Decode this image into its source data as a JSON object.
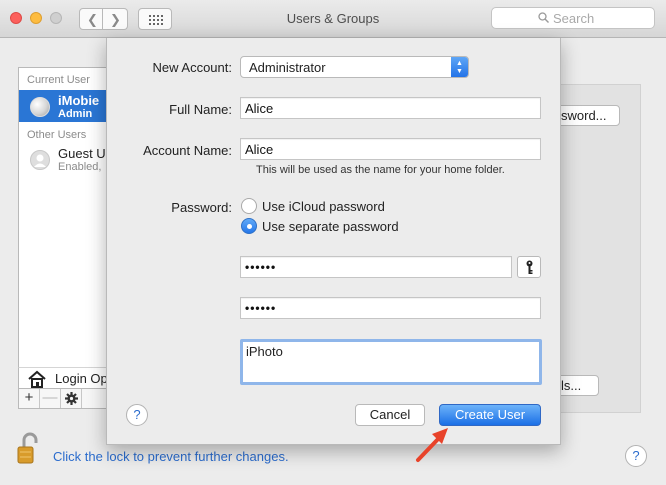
{
  "window": {
    "title": "Users & Groups"
  },
  "search": {
    "placeholder": "Search"
  },
  "user_list": {
    "current_label": "Current User",
    "other_label": "Other Users",
    "current_user": {
      "name": "iMobie",
      "role": "Admin"
    },
    "other_users": [
      {
        "name": "Guest U",
        "status": "Enabled,"
      }
    ],
    "login_options": "Login Op"
  },
  "list_bar": {
    "add": "+",
    "remove": "—"
  },
  "background_buttons": {
    "change_password": "sword...",
    "parental": "ls..."
  },
  "lock": {
    "text": "Click the lock to prevent further changes."
  },
  "help": {
    "glyph": "?"
  },
  "sheet": {
    "new_account_label": "New Account:",
    "new_account_value": "Administrator",
    "full_name_label": "Full Name:",
    "full_name_value": "Alice",
    "account_name_label": "Account Name:",
    "account_name_value": "Alice",
    "account_name_hint": "This will be used as the name for your home folder.",
    "password_label": "Password:",
    "radio_icloud": "Use iCloud password",
    "radio_separate": "Use separate password",
    "selected_radio": "separate",
    "password_value": "••••••",
    "verify_value": "••••••",
    "hint_value": "iPhoto",
    "cancel_label": "Cancel",
    "create_label": "Create User"
  },
  "colors": {
    "accent": "#2b6ccd",
    "selection": "#2a76d5",
    "annotation_arrow": "#e8432a"
  }
}
